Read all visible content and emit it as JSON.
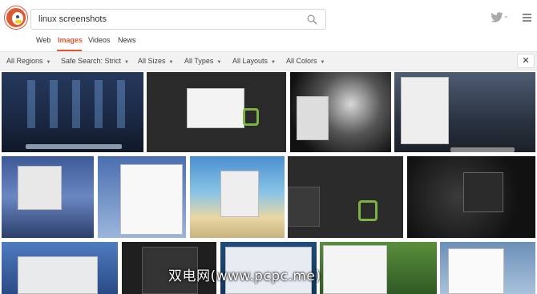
{
  "search": {
    "value": "linux screenshots"
  },
  "tabs": [
    {
      "label": "Web",
      "active": false
    },
    {
      "label": "Images",
      "active": true
    },
    {
      "label": "Videos",
      "active": false
    },
    {
      "label": "News",
      "active": false
    }
  ],
  "filters": [
    {
      "label": "All Regions"
    },
    {
      "label": "Safe Search: Strict"
    },
    {
      "label": "All Sizes"
    },
    {
      "label": "All Types"
    },
    {
      "label": "All Layouts"
    },
    {
      "label": "All Colors"
    }
  ],
  "close_label": "✕",
  "accent": "#de5833",
  "icons": {
    "search": "magnifier-icon",
    "twitter": "twitter-bird-icon",
    "menu": "hamburger-icon",
    "logo": "duck-logo-icon"
  },
  "watermark": "双电网(www.pcpc.me)"
}
